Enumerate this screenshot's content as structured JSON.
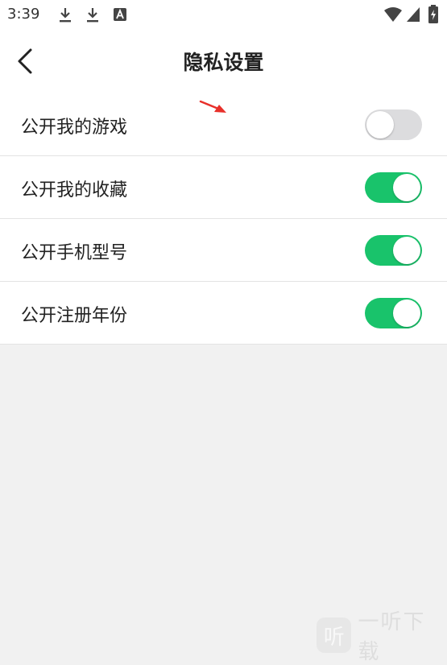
{
  "status_bar": {
    "time": "3:39",
    "left_icons": [
      "download-icon",
      "download-icon",
      "text-notification-icon"
    ],
    "right_icons": [
      "wifi-icon",
      "cell-signal-icon",
      "battery-charging-icon"
    ]
  },
  "header": {
    "title": "隐私设置",
    "back_icon": "chevron-left-icon"
  },
  "settings": [
    {
      "label": "公开我的游戏",
      "enabled": false
    },
    {
      "label": "公开我的收藏",
      "enabled": true
    },
    {
      "label": "公开手机型号",
      "enabled": true
    },
    {
      "label": "公开注册年份",
      "enabled": true
    }
  ],
  "colors": {
    "toggle_on": "#19c36b",
    "toggle_off": "#dcdcde",
    "annotation_arrow": "#e8302a",
    "background": "#f1f1f1"
  },
  "watermark": {
    "logo_char": "听",
    "text": "一听下载"
  }
}
